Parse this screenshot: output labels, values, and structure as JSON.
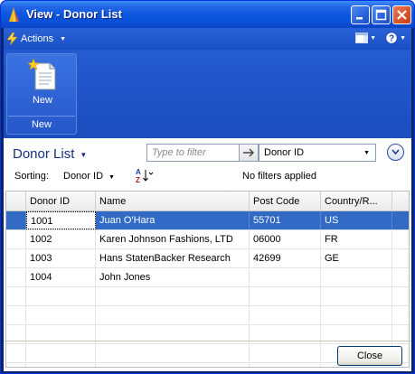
{
  "window": {
    "title": "View - Donor List"
  },
  "commandbar": {
    "actions_label": "Actions",
    "actions_icon": "lightning-icon",
    "layout_icon": "window-layout-icon",
    "help_icon": "help-icon"
  },
  "ribbon": {
    "new_button_label": "New",
    "new_icon": "new-document-icon",
    "group_label": "New"
  },
  "page": {
    "title": "Donor List"
  },
  "filter": {
    "placeholder": "Type to filter",
    "field": "Donor ID",
    "status": "No filters applied"
  },
  "sorting": {
    "label": "Sorting:",
    "field": "Donor ID",
    "sort_icon": "sort-az-icon"
  },
  "grid": {
    "columns": [
      "Donor ID",
      "Name",
      "Post Code",
      "Country/R..."
    ],
    "rows": [
      {
        "donor_id": "1001",
        "name": "Juan O'Hara",
        "post_code": "55701",
        "country": "US"
      },
      {
        "donor_id": "1002",
        "name": "Karen Johnson Fashions, LTD",
        "post_code": "06000",
        "country": "FR"
      },
      {
        "donor_id": "1003",
        "name": "Hans StatenBacker Research",
        "post_code": "42699",
        "country": "GE"
      },
      {
        "donor_id": "1004",
        "name": "John Jones",
        "post_code": "",
        "country": ""
      }
    ]
  },
  "footer": {
    "close_label": "Close"
  },
  "colors": {
    "titlebar": "#0c56e0",
    "selection": "#316ac5",
    "page_title": "#15317e"
  }
}
